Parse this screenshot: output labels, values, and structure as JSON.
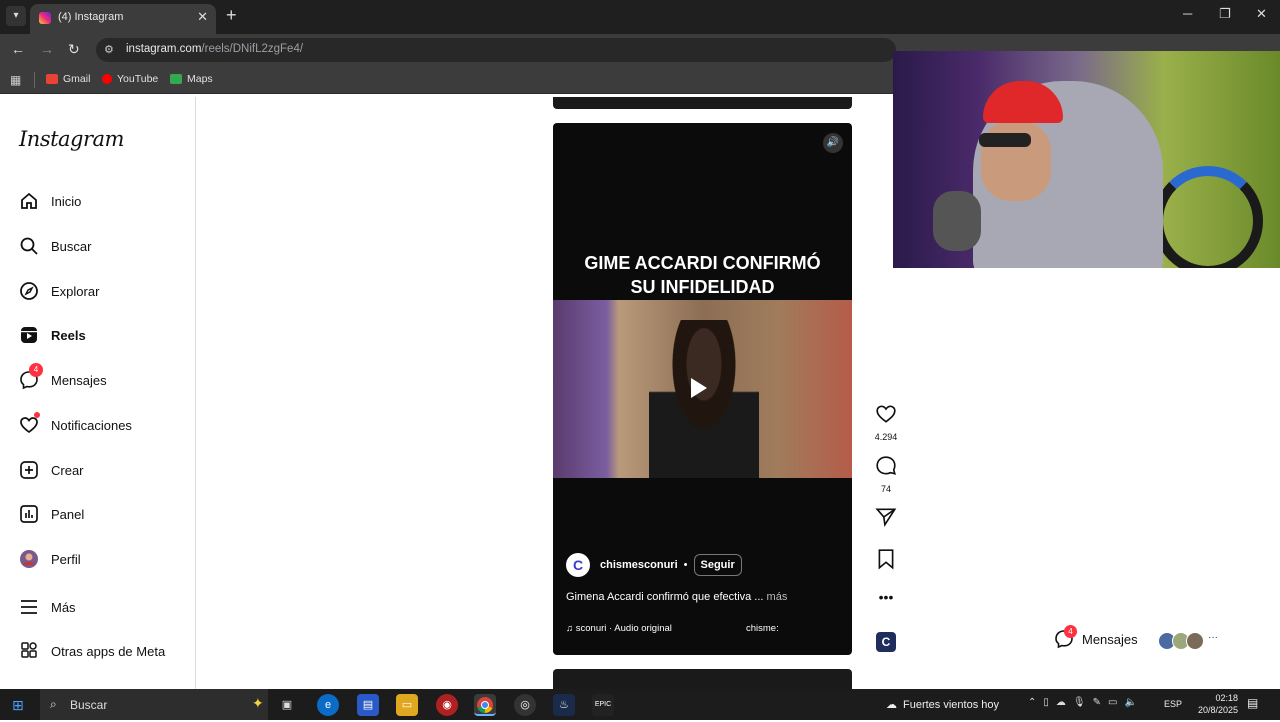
{
  "browser": {
    "tab_title": "(4) Instagram",
    "url_host": "instagram.com",
    "url_path": "/reels/DNifL2zgFe4/",
    "bookmarks": [
      {
        "label": "Gmail",
        "color": "#ea4335"
      },
      {
        "label": "YouTube",
        "color": "#ff0000"
      },
      {
        "label": "Maps",
        "color": "#34a853"
      }
    ]
  },
  "sidebar": {
    "logo": "Instagram",
    "items": [
      {
        "label": "Inicio",
        "icon": "home-icon"
      },
      {
        "label": "Buscar",
        "icon": "search-icon"
      },
      {
        "label": "Explorar",
        "icon": "compass-icon"
      },
      {
        "label": "Reels",
        "icon": "reels-icon"
      },
      {
        "label": "Mensajes",
        "icon": "messenger-icon",
        "badge": "4"
      },
      {
        "label": "Notificaciones",
        "icon": "heart-icon"
      },
      {
        "label": "Crear",
        "icon": "plus-square-icon"
      },
      {
        "label": "Panel",
        "icon": "chart-icon"
      },
      {
        "label": "Perfil",
        "icon": "profile-avatar-icon"
      },
      {
        "label": "Más",
        "icon": "hamburger-icon"
      },
      {
        "label": "Otras apps de Meta",
        "icon": "apps-grid-icon"
      }
    ]
  },
  "reel": {
    "title_line1": "GIME ACCARDI CONFIRMÓ",
    "title_line2": "SU INFIDELIDAD",
    "author_initial": "C",
    "username": "chismesconuri",
    "bullet": "•",
    "follow_label": "Seguir",
    "caption": "Gimena Accardi confirmó que efectiva ...",
    "caption_more": "más",
    "audio": "sconuri · Audio original",
    "audio_tag": "chisme:"
  },
  "actions": {
    "likes": "4.294",
    "comments": "74"
  },
  "messages_pill": {
    "label": "Mensajes",
    "badge": "4"
  },
  "taskbar": {
    "search_placeholder": "Buscar",
    "weather": "Fuertes vientos hoy",
    "lang": "ESP",
    "time": "02:18",
    "date": "20/8/2025"
  }
}
